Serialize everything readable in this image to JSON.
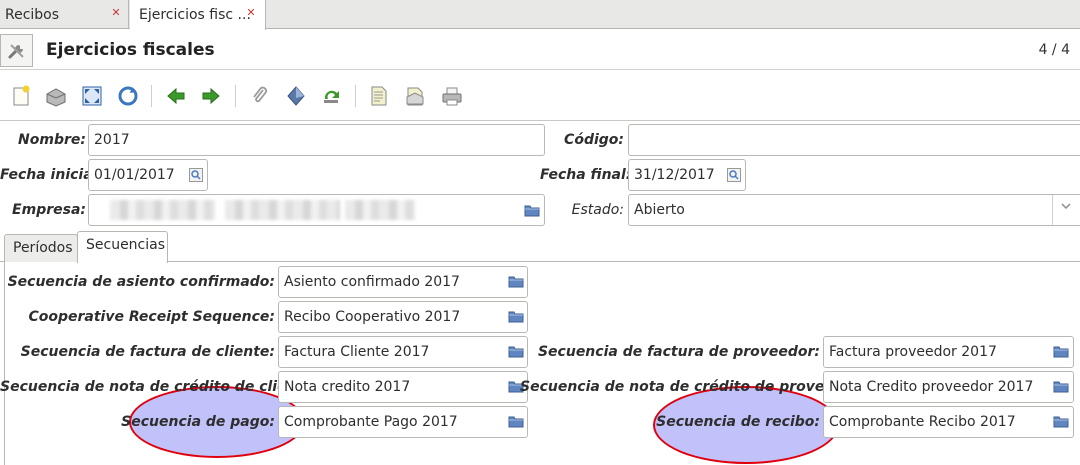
{
  "tabs": [
    {
      "label": "Recibos",
      "active": false
    },
    {
      "label": "Ejercicios fisc ...",
      "active": true
    }
  ],
  "title": "Ejercicios fiscales",
  "page_count": "4 / 4",
  "toolbar": {
    "icons": [
      "new-record-icon",
      "save-icon",
      "fullscreen-icon",
      "reload-icon",
      "previous-icon",
      "next-icon",
      "attachment-icon",
      "actions-icon",
      "relate-icon",
      "report-icon",
      "email-icon",
      "print-icon"
    ]
  },
  "form": {
    "nombre_label": "Nombre:",
    "nombre_value": "2017",
    "codigo_label": "Código:",
    "codigo_value": "",
    "fecha_inicial_label": "Fecha inicial:",
    "fecha_inicial_value": "01/01/2017",
    "fecha_final_label": "Fecha final:",
    "fecha_final_value": "31/12/2017",
    "empresa_label": "Empresa:",
    "estado_label": "Estado:",
    "estado_value": "Abierto"
  },
  "inner_tabs": [
    {
      "label": "Períodos",
      "active": false
    },
    {
      "label": "Secuencias",
      "active": true
    }
  ],
  "secuencias": {
    "asiento_label": "Secuencia de asiento confirmado:",
    "asiento_value": "Asiento confirmado 2017",
    "coop_label": "Cooperative Receipt Sequence:",
    "coop_value": "Recibo Cooperativo 2017",
    "factura_cliente_label": "Secuencia de factura de cliente:",
    "factura_cliente_value": "Factura Cliente 2017",
    "factura_proveedor_label": "Secuencia de factura de proveedor:",
    "factura_proveedor_value": "Factura proveedor 2017",
    "nota_cliente_label": "Secuencia de nota de crédito de cliente:",
    "nota_cliente_value": "Nota credito 2017",
    "nota_proveedor_label": "Secuencia de nota de crédito de proveedor:",
    "nota_proveedor_value": "Nota Credito proveedor 2017",
    "pago_label": "Secuencia de pago:",
    "pago_value": "Comprobante Pago 2017",
    "recibo_label": "Secuencia de recibo:",
    "recibo_value": "Comprobante Recibo 2017"
  },
  "colors": {
    "highlight_fill": "#aaaafa",
    "highlight_stroke": "#e0000d",
    "close_icon": "#c83737",
    "arrow_green": "#3c9a2a"
  }
}
